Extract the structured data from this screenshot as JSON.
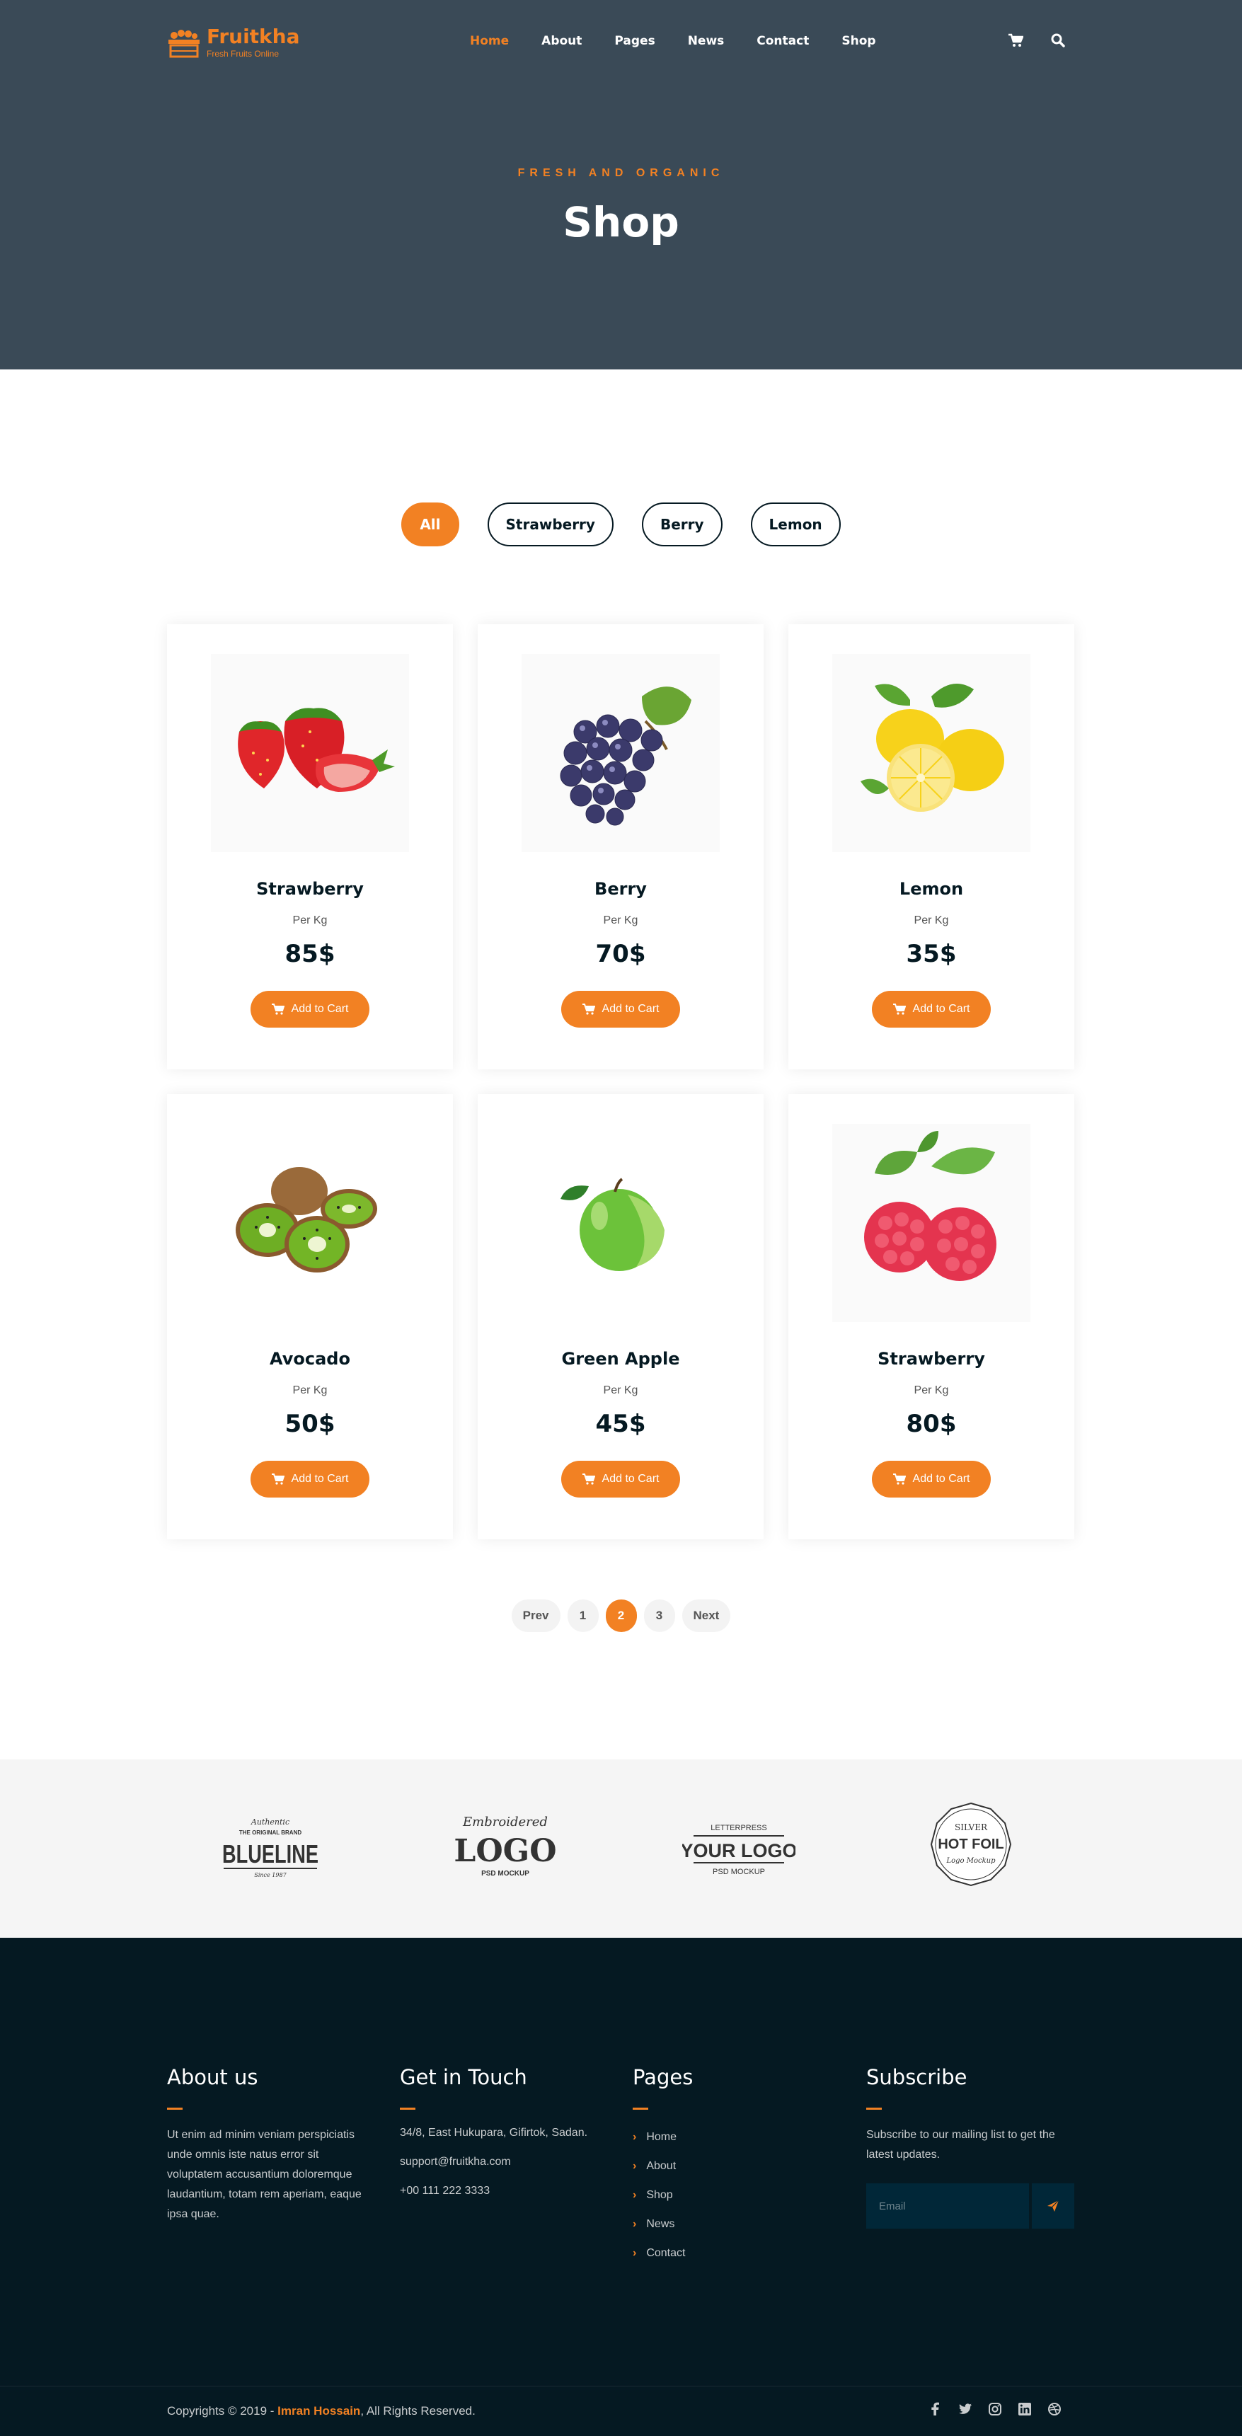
{
  "header": {
    "logo_name": "Fruitkha",
    "logo_tagline": "Fresh Fruits Online",
    "nav": [
      "Home",
      "About",
      "Pages",
      "News",
      "Contact",
      "Shop"
    ],
    "active_nav": "Home",
    "icons": [
      "shopping-cart-icon",
      "search-icon"
    ]
  },
  "hero": {
    "subtitle": "FRESH AND ORGANIC",
    "title": "Shop"
  },
  "filters": [
    "All",
    "Strawberry",
    "Berry",
    "Lemon"
  ],
  "active_filter": "All",
  "products": [
    {
      "name": "Strawberry",
      "unit": "Per Kg",
      "price": "85$",
      "button": "Add to Cart",
      "image": "strawberry"
    },
    {
      "name": "Berry",
      "unit": "Per Kg",
      "price": "70$",
      "button": "Add to Cart",
      "image": "grapes"
    },
    {
      "name": "Lemon",
      "unit": "Per Kg",
      "price": "35$",
      "button": "Add to Cart",
      "image": "lemon"
    },
    {
      "name": "Avocado",
      "unit": "Per Kg",
      "price": "50$",
      "button": "Add to Cart",
      "image": "kiwi"
    },
    {
      "name": "Green Apple",
      "unit": "Per Kg",
      "price": "45$",
      "button": "Add to Cart",
      "image": "green-apple"
    },
    {
      "name": "Strawberry",
      "unit": "Per Kg",
      "price": "80$",
      "button": "Add to Cart",
      "image": "raspberry"
    }
  ],
  "pagination": {
    "prev": "Prev",
    "pages": [
      "1",
      "2",
      "3"
    ],
    "active": "2",
    "next": "Next"
  },
  "brands": {
    "blueline": {
      "top": "Authentic",
      "mid": "THE ORIGINAL BRAND",
      "name": "BLUELINE",
      "foot": "Since 1987"
    },
    "embroidered": {
      "top": "Embroidered",
      "name": "LOGO",
      "foot": "PSD MOCKUP"
    },
    "letterpress": {
      "top": "LETTERPRESS",
      "name": "YOUR LOGO",
      "foot": "PSD MOCKUP"
    },
    "hotfoil": {
      "top": "SILVER",
      "name": "HOT FOIL",
      "foot": "Logo Mockup"
    }
  },
  "footer": {
    "about": {
      "title": "About us",
      "text": "Ut enim ad minim veniam perspiciatis unde omnis iste natus error sit voluptatem accusantium doloremque laudantium, totam rem aperiam, eaque ipsa quae."
    },
    "contact": {
      "title": "Get in Touch",
      "address": "34/8, East Hukupara, Gifirtok, Sadan.",
      "email": "support@fruitkha.com",
      "phone": "+00 111 222 3333"
    },
    "pages": {
      "title": "Pages",
      "links": [
        "Home",
        "About",
        "Shop",
        "News",
        "Contact"
      ]
    },
    "subscribe": {
      "title": "Subscribe",
      "text": "Subscribe to our mailing list to get the latest updates.",
      "placeholder": "Email"
    },
    "copyright_prefix": "Copyrights © 2019 - ",
    "copyright_author": "Imran Hossain",
    "copyright_suffix": ",  All Rights Reserved.",
    "socials": [
      "facebook-icon",
      "twitter-icon",
      "instagram-icon",
      "linkedin-icon",
      "dribbble-icon"
    ]
  },
  "colors": {
    "accent": "#f28123",
    "hero_bg": "#3a4a57",
    "footer_bg": "#051922",
    "text_dark": "#051922"
  }
}
